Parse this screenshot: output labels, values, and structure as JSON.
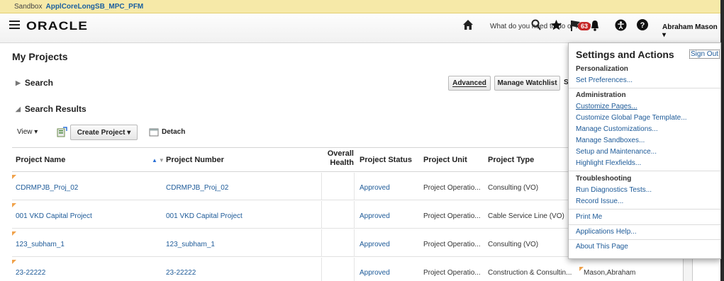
{
  "sandbox": {
    "label": "Sandbox",
    "name": "ApplCoreLongSB_MPC_PFM"
  },
  "header": {
    "logo": "ORACLE",
    "search_prompt": "What do you need to do or find?",
    "notifications_count": "63",
    "user": "Abraham Mason"
  },
  "page": {
    "title": "My Projects"
  },
  "search_section": {
    "label": "Search",
    "advanced_button": "Advanced",
    "watchlist_button": "Manage Watchlist",
    "cut_text": "S"
  },
  "results_section": {
    "label": "Search Results"
  },
  "toolbar": {
    "view_label": "View",
    "create_button": "Create Project",
    "detach_label": "Detach"
  },
  "table": {
    "headers": {
      "project_name": "Project Name",
      "project_number": "Project Number",
      "overall_health_1": "Overall",
      "overall_health_2": "Health",
      "project_status": "Project Status",
      "project_unit": "Project Unit",
      "project_type": "Project Type"
    },
    "rows": [
      {
        "name": "CDRMPJB_Proj_02",
        "number": "CDRMPJB_Proj_02",
        "status": "Approved",
        "unit": "Project Operatio...",
        "type": "Consulting (VO)",
        "manager": ""
      },
      {
        "name": "001 VKD Capital Project",
        "number": "001 VKD Capital Project",
        "status": "Approved",
        "unit": "Project Operatio...",
        "type": "Cable Service Line (VO)",
        "manager": ""
      },
      {
        "name": "123_subham_1",
        "number": "123_subham_1",
        "status": "Approved",
        "unit": "Project Operatio...",
        "type": "Consulting (VO)",
        "manager": ""
      },
      {
        "name": "23-22222",
        "number": "23-22222",
        "status": "Approved",
        "unit": "Project Operatio...",
        "type": "Construction & Consultin...",
        "manager": "Mason,Abraham"
      }
    ]
  },
  "settings_popup": {
    "title": "Settings and Actions",
    "sign_out": "Sign Out",
    "groups": {
      "personalization": {
        "heading": "Personalization",
        "items": [
          "Set Preferences..."
        ]
      },
      "administration": {
        "heading": "Administration",
        "items": [
          "Customize Pages...",
          "Customize Global Page Template...",
          "Manage Customizations...",
          "Manage Sandboxes...",
          "Setup and Maintenance...",
          "Highlight Flexfields..."
        ]
      },
      "troubleshooting": {
        "heading": "Troubleshooting",
        "items": [
          "Run Diagnostics Tests...",
          "Record Issue..."
        ]
      },
      "misc": {
        "items": [
          "Print Me",
          "Applications Help...",
          "About This Page"
        ]
      }
    }
  },
  "colors": {
    "link": "#1d5a98",
    "sandbox_bg": "#f6e9a8",
    "badge": "#c62828",
    "sort_active": "#2a6fd6",
    "flag": "#f0a24b"
  }
}
